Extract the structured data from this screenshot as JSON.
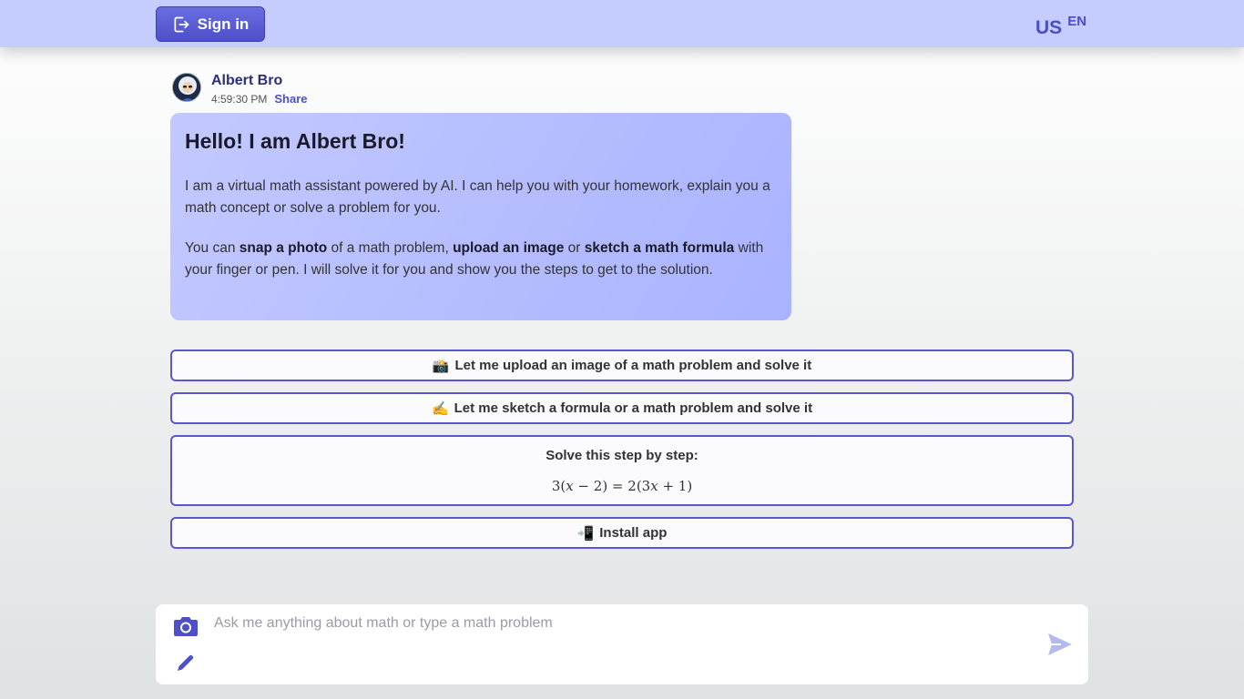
{
  "header": {
    "signin_label": "Sign in",
    "country": "US",
    "language": "EN"
  },
  "message": {
    "author": "Albert Bro",
    "time": "4:59:30 PM",
    "share_label": "Share",
    "title": "Hello! I am Albert Bro!",
    "p1": "I am a virtual math assistant powered by AI. I can help you with your homework, explain you a math concept or solve a problem for you.",
    "p2_a": "You can ",
    "p2_b": "snap a photo",
    "p2_c": " of a math problem, ",
    "p2_d": "upload an image",
    "p2_e": " or ",
    "p2_f": "sketch a math formula",
    "p2_g": " with your finger or pen. I will solve it for you and show you the steps to get to the solution."
  },
  "suggestions": {
    "upload": {
      "emoji": "📸",
      "label": "Let me upload an image of a math problem and solve it"
    },
    "sketch": {
      "emoji": "✍️",
      "label": "Let me sketch a formula or a math problem and solve it"
    },
    "solve": {
      "label": "Solve this step by step:",
      "formula": "3(𝑥 − 2) = 2(3𝑥 + 1)"
    },
    "install": {
      "emoji": "📲",
      "label": "Install app"
    }
  },
  "input": {
    "placeholder": "Ask me anything about math or type a math problem",
    "value": ""
  },
  "icons": {
    "signin": "sign-in-icon",
    "camera": "camera-icon",
    "pencil": "pencil-icon",
    "send": "send-icon"
  },
  "colors": {
    "accent": "#4f4fc9",
    "header_bg": "#c5cdff",
    "bubble_bg": "#b4bcff"
  }
}
